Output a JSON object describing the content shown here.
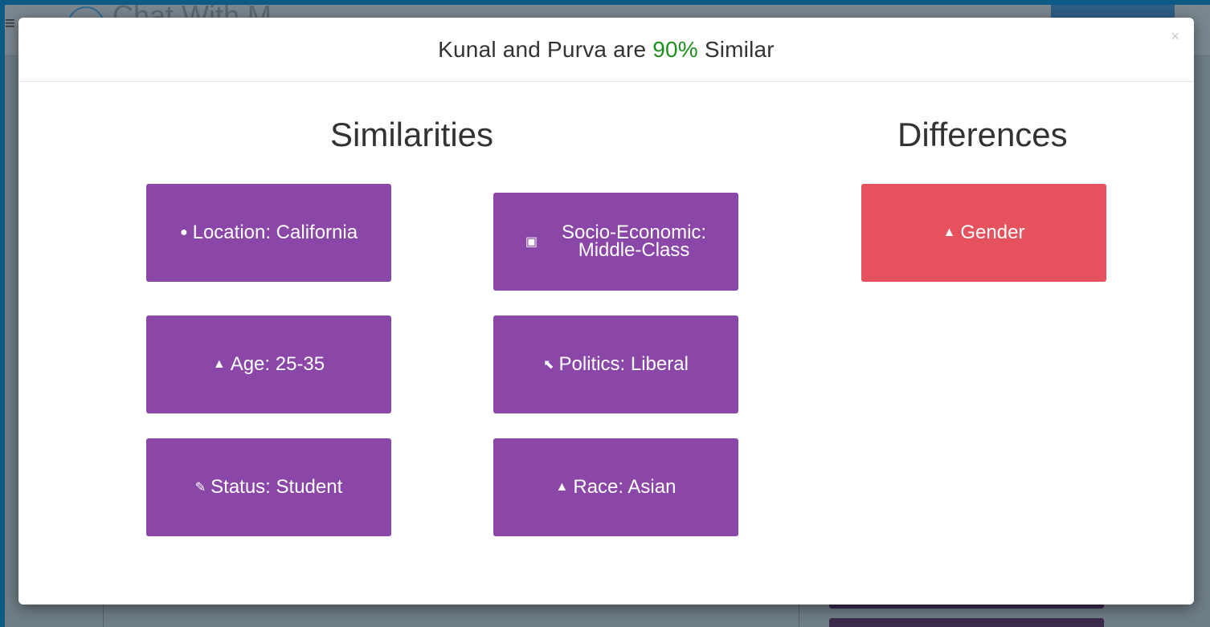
{
  "background": {
    "logo_text": "Chat With M",
    "accent": "#0d5a86"
  },
  "modal": {
    "title_prefix": "Kunal and Purva are ",
    "similarity_percent": "90%",
    "title_suffix": " Similar",
    "close_label": "×"
  },
  "similarities": {
    "heading": "Similarities",
    "items": [
      {
        "icon": "globe-icon",
        "glyph": "●",
        "label": "Location: California"
      },
      {
        "icon": "money-icon",
        "glyph": "▣",
        "label": "Socio-Economic: Middle-Class",
        "line1": "Socio-Economic:",
        "line2": "Middle-Class"
      },
      {
        "icon": "person-icon",
        "glyph": "▲",
        "label": "Age: 25-35"
      },
      {
        "icon": "gavel-icon",
        "glyph": "⬉",
        "label": "Politics: Liberal"
      },
      {
        "icon": "pencil-icon",
        "glyph": "✎",
        "label": "Status: Student"
      },
      {
        "icon": "person-icon",
        "glyph": "▲",
        "label": "Race: Asian"
      }
    ]
  },
  "differences": {
    "heading": "Differences",
    "items": [
      {
        "icon": "person-icon",
        "glyph": "▲",
        "label": "Gender"
      }
    ]
  },
  "colors": {
    "similarity_tile": "#8b47a8",
    "difference_tile": "#e5515c",
    "percent_text": "#1e8f1e"
  }
}
